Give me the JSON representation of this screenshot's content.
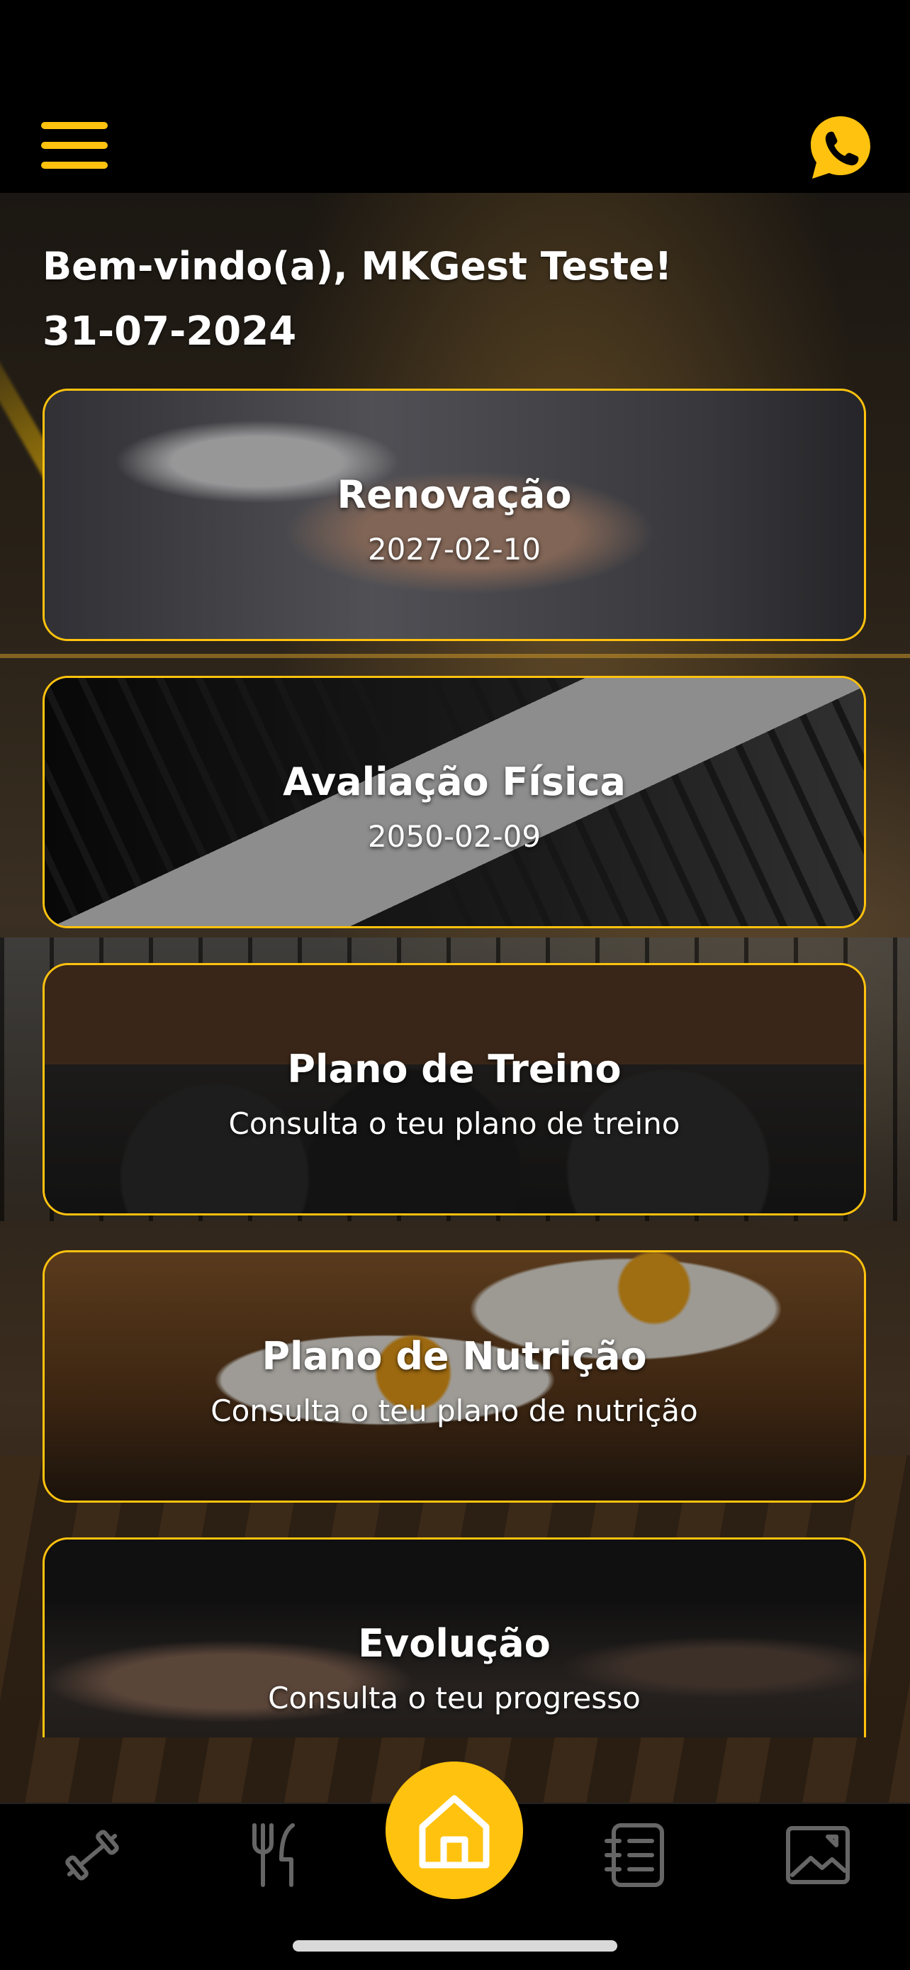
{
  "header": {
    "menu_icon": "hamburger-menu-icon",
    "contact_icon": "whatsapp-icon",
    "accent_color": "#FFC20E"
  },
  "welcome": {
    "greeting": "Bem-vindo(a), MKGest Teste!",
    "date": "31-07-2024"
  },
  "cards": [
    {
      "title": "Renovação",
      "subtitle": "2027-02-10",
      "image": "handshake"
    },
    {
      "title": "Avaliação Física",
      "subtitle": "2050-02-09",
      "image": "measuring-tape"
    },
    {
      "title": "Plano de Treino",
      "subtitle": "Consulta o teu plano de treino",
      "image": "kettlebells"
    },
    {
      "title": "Plano de Nutrição",
      "subtitle": "Consulta o teu plano de nutrição",
      "image": "eggs-on-toast"
    },
    {
      "title": "Evolução",
      "subtitle": "Consulta o teu progresso",
      "image": "fitness-body"
    }
  ],
  "bottom_nav": {
    "items": [
      {
        "icon": "dumbbell-icon",
        "active": false
      },
      {
        "icon": "fork-knife-icon",
        "active": false
      },
      {
        "icon": "home-icon",
        "active": true
      },
      {
        "icon": "checklist-icon",
        "active": false
      },
      {
        "icon": "gallery-icon",
        "active": false
      }
    ]
  }
}
